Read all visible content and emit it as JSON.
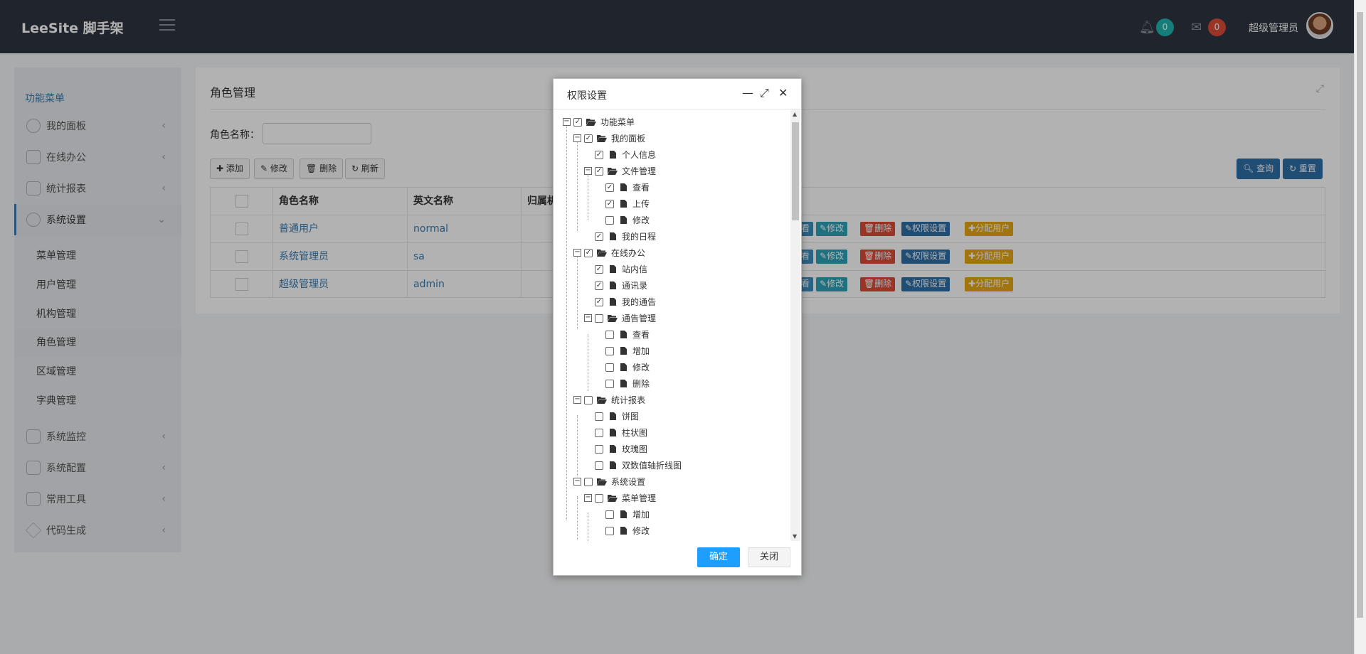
{
  "header": {
    "brand": "LeeSite 脚手架",
    "notifications_count": "0",
    "messages_count": "0",
    "user_name": "超级管理员"
  },
  "sidebar": {
    "title": "功能菜单",
    "items": [
      {
        "label": "我的面板",
        "chevron": "‹"
      },
      {
        "label": "在线办公",
        "chevron": "‹"
      },
      {
        "label": "统计报表",
        "chevron": "‹"
      },
      {
        "label": "系统设置",
        "chevron": "⌄"
      },
      {
        "label": "系统监控",
        "chevron": "‹"
      },
      {
        "label": "系统配置",
        "chevron": "‹"
      },
      {
        "label": "常用工具",
        "chevron": "‹"
      },
      {
        "label": "代码生成",
        "chevron": "‹"
      }
    ],
    "sub_items": [
      "菜单管理",
      "用户管理",
      "机构管理",
      "角色管理",
      "区域管理",
      "字典管理"
    ]
  },
  "main": {
    "title": "角色管理",
    "search_label": "角色名称：",
    "toolbar": {
      "add": "添加",
      "edit": "修改",
      "delete": "删除",
      "refresh": "刷新",
      "query": "查询",
      "reset": "重置"
    },
    "columns": [
      "角色名称",
      "英文名称",
      "归属机"
    ],
    "rows": [
      {
        "name": "普通用户",
        "en": "normal"
      },
      {
        "name": "系统管理员",
        "en": "sa"
      },
      {
        "name": "超级管理员",
        "en": "admin"
      }
    ],
    "row_actions": {
      "view": "查看",
      "edit": "修改",
      "delete": "删除",
      "perm": "权限设置",
      "assign": "分配用户"
    }
  },
  "dialog": {
    "title": "权限设置",
    "ok": "确定",
    "close": "关闭",
    "tree": [
      {
        "label": "功能菜单",
        "checked": true
      },
      {
        "label": "我的面板",
        "checked": true
      },
      {
        "label": "个人信息",
        "checked": true
      },
      {
        "label": "文件管理",
        "checked": true
      },
      {
        "label": "查看",
        "checked": true
      },
      {
        "label": "上传",
        "checked": true
      },
      {
        "label": "修改",
        "checked": false
      },
      {
        "label": "我的日程",
        "checked": true
      },
      {
        "label": "在线办公",
        "checked": true
      },
      {
        "label": "站内信",
        "checked": true
      },
      {
        "label": "通讯录",
        "checked": true
      },
      {
        "label": "我的通告",
        "checked": true
      },
      {
        "label": "通告管理",
        "checked": false
      },
      {
        "label": "查看",
        "checked": false
      },
      {
        "label": "增加",
        "checked": false
      },
      {
        "label": "修改",
        "checked": false
      },
      {
        "label": "删除",
        "checked": false
      },
      {
        "label": "统计报表",
        "checked": false
      },
      {
        "label": "饼图",
        "checked": false
      },
      {
        "label": "柱状图",
        "checked": false
      },
      {
        "label": "玫瑰图",
        "checked": false
      },
      {
        "label": "双数值轴折线图",
        "checked": false
      },
      {
        "label": "系统设置",
        "checked": false
      },
      {
        "label": "菜单管理",
        "checked": false
      },
      {
        "label": "增加",
        "checked": false
      },
      {
        "label": "修改",
        "checked": false
      }
    ]
  },
  "colors": {
    "header_bg": "#2f3541",
    "teal_badge": "#1fb5ad",
    "red_badge": "#dd4b39",
    "primary": "#2f6fa7",
    "ok_button": "#1e9fff"
  },
  "icons": [
    "menu-toggle-icon",
    "bell-icon",
    "envelope-icon",
    "gauge-icon",
    "desktop-icon",
    "bar-chart-icon",
    "gear-icon",
    "video-icon",
    "sliders-icon",
    "wrench-icon",
    "star-icon",
    "expand-icon",
    "minimize-icon",
    "maximize-icon",
    "close-icon",
    "folder-open-icon",
    "file-icon"
  ]
}
